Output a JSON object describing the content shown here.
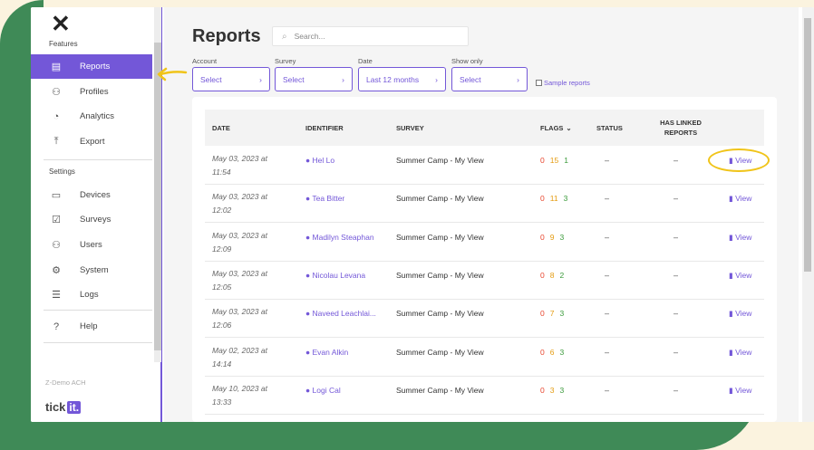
{
  "sidebar": {
    "features_label": "Features",
    "features": [
      {
        "label": "Reports",
        "icon": "reports-icon",
        "active": true
      },
      {
        "label": "Profiles",
        "icon": "profile-icon"
      },
      {
        "label": "Analytics",
        "icon": "analytics-icon"
      },
      {
        "label": "Export",
        "icon": "export-icon"
      }
    ],
    "settings_label": "Settings",
    "settings": [
      {
        "label": "Devices",
        "icon": "device-icon"
      },
      {
        "label": "Surveys",
        "icon": "survey-icon"
      },
      {
        "label": "Users",
        "icon": "users-icon"
      },
      {
        "label": "System",
        "icon": "gear-icon"
      },
      {
        "label": "Logs",
        "icon": "logs-icon"
      }
    ],
    "help_label": "Help",
    "org_name": "Z-Demo ACH",
    "logo_text": "tick",
    "logo_box": "it."
  },
  "main": {
    "title": "Reports",
    "search_placeholder": "Search...",
    "filters": [
      {
        "label": "Account",
        "value": "Select"
      },
      {
        "label": "Survey",
        "value": "Select"
      },
      {
        "label": "Date",
        "value": "Last 12 months"
      },
      {
        "label": "Show only",
        "value": "Select"
      }
    ],
    "sample_label": "Sample reports",
    "columns": {
      "date": "DATE",
      "identifier": "IDENTIFIER",
      "survey": "SURVEY",
      "flags": "FLAGS",
      "status": "STATUS",
      "linked": "HAS LINKED REPORTS"
    },
    "rows": [
      {
        "date": "May 03, 2023 at 11:54",
        "identifier": "Hel Lo",
        "survey": "Summer Camp - My View",
        "red": "0",
        "amber": "15",
        "green": "1",
        "status": "–",
        "linked": "–",
        "action": "View"
      },
      {
        "date": "May 03, 2023 at 12:02",
        "identifier": "Tea Bitter",
        "survey": "Summer Camp - My View",
        "red": "0",
        "amber": "11",
        "green": "3",
        "status": "–",
        "linked": "–",
        "action": "View"
      },
      {
        "date": "May 03, 2023 at 12:09",
        "identifier": "Madilyn Steaphan",
        "survey": "Summer Camp - My View",
        "red": "0",
        "amber": "9",
        "green": "3",
        "status": "–",
        "linked": "–",
        "action": "View"
      },
      {
        "date": "May 03, 2023 at 12:05",
        "identifier": "Nicolau Levana",
        "survey": "Summer Camp - My View",
        "red": "0",
        "amber": "8",
        "green": "2",
        "status": "–",
        "linked": "–",
        "action": "View"
      },
      {
        "date": "May 03, 2023 at 12:06",
        "identifier": "Naveed Leachlai...",
        "survey": "Summer Camp - My View",
        "red": "0",
        "amber": "7",
        "green": "3",
        "status": "–",
        "linked": "–",
        "action": "View"
      },
      {
        "date": "May 02, 2023 at 14:14",
        "identifier": "Evan Alkin",
        "survey": "Summer Camp - My View",
        "red": "0",
        "amber": "6",
        "green": "3",
        "status": "–",
        "linked": "–",
        "action": "View"
      },
      {
        "date": "May 10, 2023 at 13:33",
        "identifier": "Logi Cal",
        "survey": "Summer Camp - My View",
        "red": "0",
        "amber": "3",
        "green": "3",
        "status": "–",
        "linked": "–",
        "action": "View"
      }
    ]
  },
  "colors": {
    "accent": "#7357d8",
    "frame": "#3f8a57",
    "annotation": "#f0c419"
  }
}
